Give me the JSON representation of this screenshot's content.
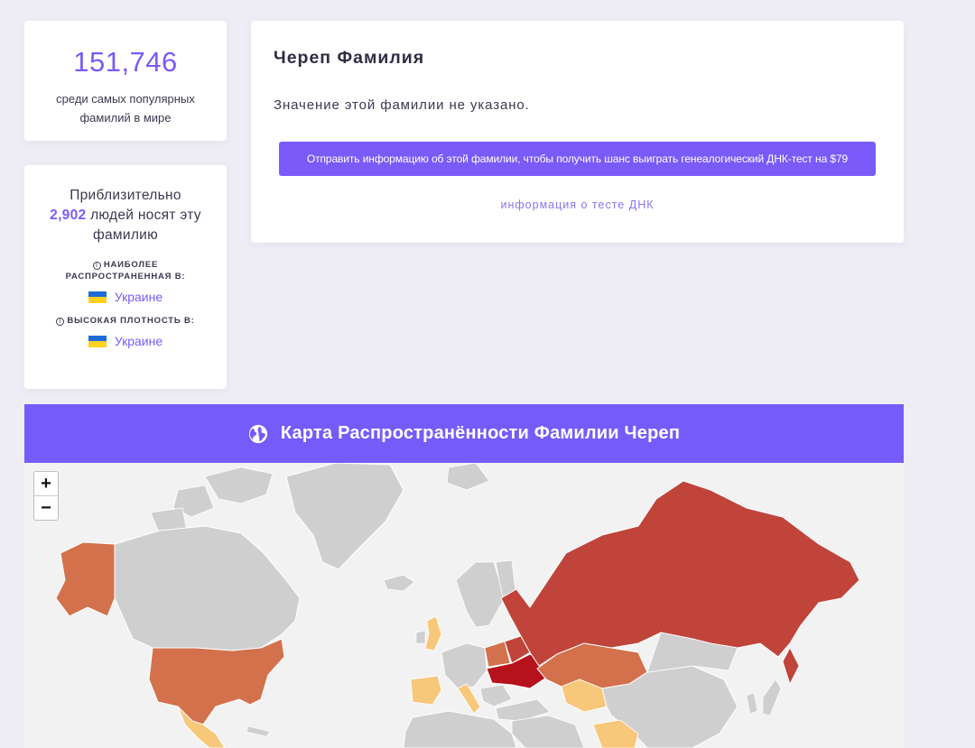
{
  "rank": {
    "value": "151,746",
    "description": "среди самых популярных фамилий в мире"
  },
  "count": {
    "prefix": "Приблизительно",
    "number": "2,902",
    "suffix": "людей носят эту фамилию",
    "most_common_label": "НАИБОЛЕЕ РАСПРОСТРАНЕННАЯ В:",
    "most_common_country": "Украине",
    "density_label": "ВЫСОКАЯ ПЛОТНОСТЬ В:",
    "density_country": "Украине",
    "info_icon": "info-icon",
    "flag_icon": "ukraine-flag-icon"
  },
  "main": {
    "title": "Череп Фамилия",
    "meaning": "Значение этой фамилии не указано.",
    "cta_label": "Отправить информацию об этой фамилии, чтобы получить шанс выиграть генеалогический ДНК-тест на $79",
    "dna_link": "информация о тесте ДНК"
  },
  "map": {
    "title": "Карта Распространённости Фамилии Череп",
    "icon": "globe-icon",
    "zoom_in": "+",
    "zoom_out": "−",
    "colors": {
      "header": "#755cfa",
      "land_none": "#cfcfcf",
      "ocean": "#f2f2f2",
      "highest": "#b5121b",
      "high": "#c0443a",
      "medium": "#d3714c",
      "low": "#f7c77a"
    }
  }
}
